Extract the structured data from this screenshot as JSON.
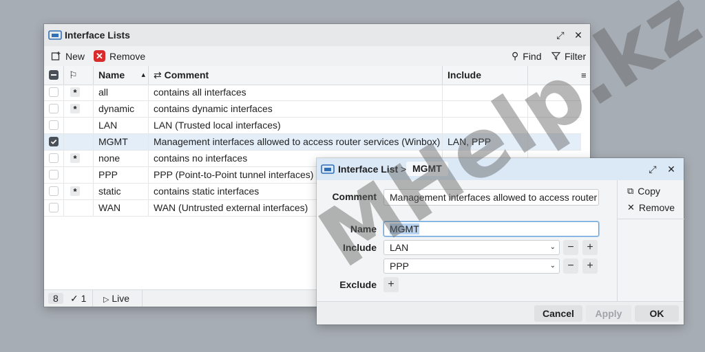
{
  "main": {
    "title": "Interface Lists",
    "toolbar": {
      "new": "New",
      "remove": "Remove",
      "find": "Find",
      "filter": "Filter"
    },
    "columns": {
      "name": "Name",
      "comment": "Comment",
      "include": "Include"
    },
    "rows": [
      {
        "flag": "*",
        "name": "all",
        "comment": "contains all interfaces",
        "include": ""
      },
      {
        "flag": "*",
        "name": "dynamic",
        "comment": "contains dynamic interfaces",
        "include": ""
      },
      {
        "flag": "",
        "name": "LAN",
        "comment": "LAN (Trusted local interfaces)",
        "include": ""
      },
      {
        "flag": "",
        "name": "MGMT",
        "comment": "Management interfaces allowed to access router services (Winbox)",
        "include": "LAN, PPP",
        "checked": true
      },
      {
        "flag": "*",
        "name": "none",
        "comment": "contains no interfaces",
        "include": ""
      },
      {
        "flag": "",
        "name": "PPP",
        "comment": "PPP (Point-to-Point tunnel interfaces)",
        "include": ""
      },
      {
        "flag": "*",
        "name": "static",
        "comment": "contains static interfaces",
        "include": ""
      },
      {
        "flag": "",
        "name": "WAN",
        "comment": "WAN (Untrusted external interfaces)",
        "include": ""
      }
    ],
    "status": {
      "count": "8",
      "selected": "1",
      "live": "Live"
    }
  },
  "dialog": {
    "crumb": "Interface List",
    "crumb_sep": ">",
    "item": "MGMT",
    "labels": {
      "comment": "Comment",
      "name": "Name",
      "include": "Include",
      "exclude": "Exclude"
    },
    "comment_value": "Management interfaces allowed to access router",
    "name_value": "MGMT",
    "include_values": [
      "LAN",
      "PPP"
    ],
    "side": {
      "copy": "Copy",
      "remove": "Remove"
    },
    "buttons": {
      "cancel": "Cancel",
      "apply": "Apply",
      "ok": "OK"
    }
  },
  "watermark": "MHelp.kz",
  "colors": {
    "selected_row": "#e3eef9",
    "dialog_title": "#dbe9f7",
    "remove_icon": "#d92b2b",
    "focus": "#6aa3d8"
  }
}
